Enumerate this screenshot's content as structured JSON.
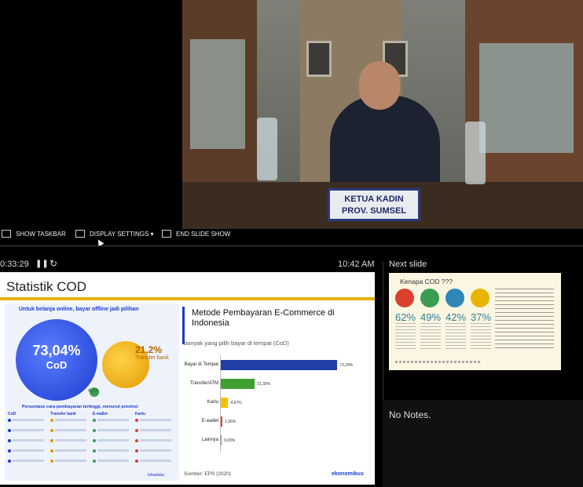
{
  "webcam": {
    "nameplate_line1": "KETUA KADIN",
    "nameplate_line2": "PROV. SUMSEL"
  },
  "toolbar": {
    "show_taskbar": "SHOW TASKBAR",
    "display_settings": "DISPLAY SETTINGS ▾",
    "end_slide_show": "END SLIDE SHOW"
  },
  "presenter": {
    "elapsed": "0:33:29",
    "clock": "10:42 AM",
    "next_slide_label": "Next slide",
    "notes": "No Notes."
  },
  "slide": {
    "title": "Statistik COD",
    "subtitle": "Untuk belanja online, bayar offline jadi pilihan",
    "cod_pct": "73,04%",
    "cod_label": "CoD",
    "transfer_pct": "21,2%",
    "transfer_label": "Transfer bank",
    "ewallet_pct": "4,6%",
    "lower_heading": "Persentase cara pembayaran tertinggi, menurut provinsi",
    "lower_cols": [
      "CoD",
      "Transfer bank",
      "E-wallet",
      "Kartu"
    ],
    "chart_title": "Metode Pembayaran E-Commerce di Indonesia",
    "chart_subtitle": "banyak yang pilih bayar di tempat (CoD)",
    "source": "Sumber: EPS (2020)",
    "brand_left": "lokadata",
    "brand_right": "ekonomikus"
  },
  "chart_data": {
    "type": "bar",
    "orientation": "horizontal",
    "title": "Metode Pembayaran E-Commerce di Indonesia",
    "subtitle": "banyak yang pilih bayar di tempat (CoD)",
    "categories": [
      "Bayar di Tempat",
      "Transfer/ATM",
      "Kartu",
      "E-wallet",
      "Lainnya"
    ],
    "values": [
      73.24,
      21.3,
      4.67,
      1.06,
      0.09
    ],
    "value_labels": [
      "73,24%",
      "21,30%",
      "4,67%",
      "1,06%",
      "0,09%"
    ],
    "colors": [
      "#1f3fa8",
      "#3f9f2f",
      "#f2c400",
      "#e0443a",
      "#888888"
    ],
    "xlim": [
      0,
      80
    ]
  },
  "next_slide": {
    "title": "Kenapa COD ???",
    "pcts": [
      "62%",
      "49%",
      "42%",
      "37%"
    ],
    "icon_colors": [
      "#d9412e",
      "#3a9d52",
      "#2f86b8",
      "#e7b500"
    ]
  }
}
